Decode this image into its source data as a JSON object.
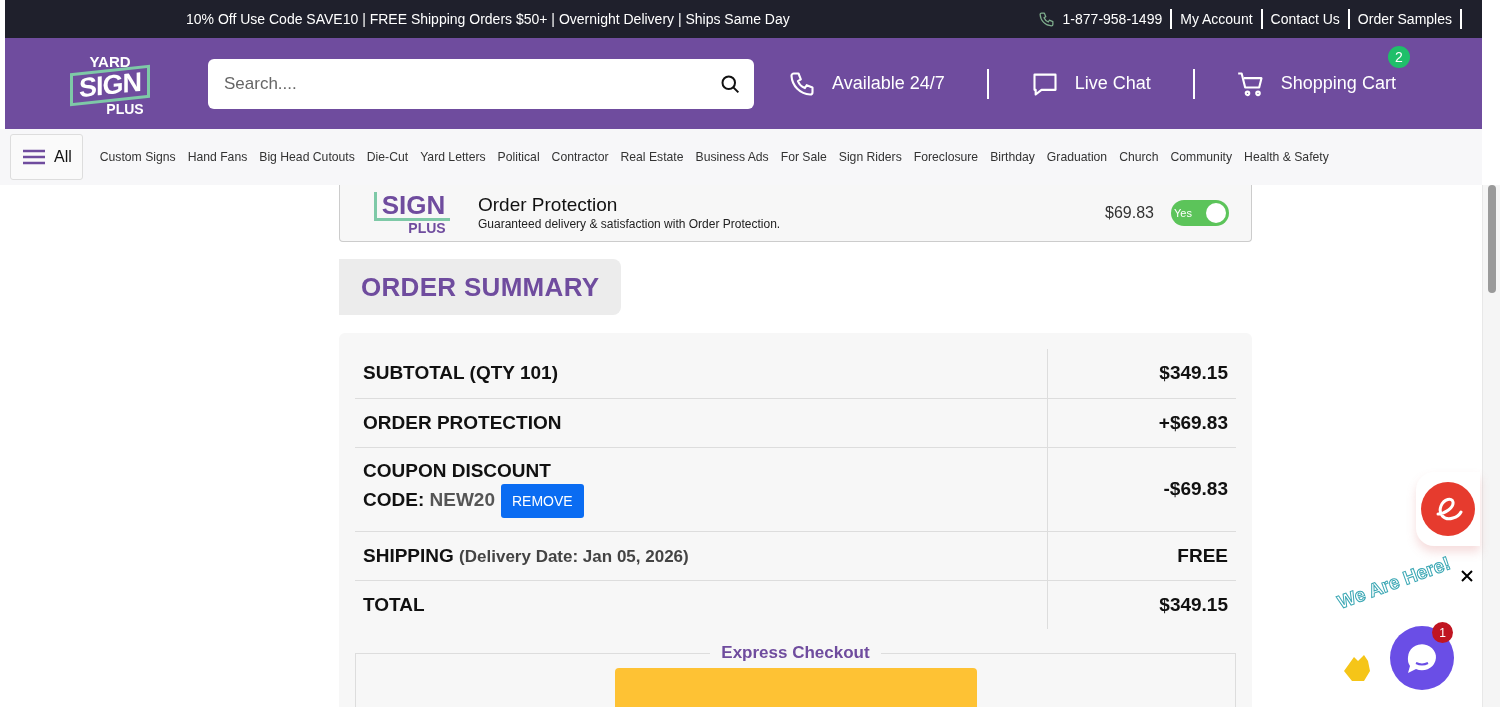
{
  "announcement": "10% Off Use Code SAVE10 | FREE Shipping Orders $50+ | Overnight Delivery | Ships Same Day",
  "top_links": [
    {
      "kind": "phone",
      "label": "1-877-958-1499"
    },
    {
      "kind": "link",
      "label": "My Account"
    },
    {
      "kind": "link",
      "label": "Contact Us"
    },
    {
      "kind": "link",
      "label": "Order Samples"
    }
  ],
  "header": {
    "logo": [
      "YARD",
      "SIGN",
      "PLUS"
    ],
    "search": {
      "placeholder": "Search...."
    },
    "actions": [
      {
        "kind": "phone",
        "label": "Available 24/7"
      },
      {
        "kind": "chat",
        "label": "Live Chat"
      },
      {
        "kind": "cart",
        "label": "Shopping Cart",
        "badge": "2"
      }
    ]
  },
  "nav": {
    "menu_label": "All",
    "items": [
      "Custom Signs",
      "Hand Fans",
      "Big Head Cutouts",
      "Die-Cut",
      "Yard Letters",
      "Political",
      "Contractor",
      "Real Estate",
      "Business Ads",
      "For Sale",
      "Sign Riders",
      "Foreclosure",
      "Birthday",
      "Graduation",
      "Church",
      "Community",
      "Health & Safety"
    ]
  },
  "order_protection": {
    "logo": [
      "SIGN",
      "PLUS"
    ],
    "title": "Order Protection",
    "description": "Guaranteed delivery & satisfaction with Order Protection.",
    "price": "$69.83",
    "toggle": {
      "label": "Yes",
      "on": true
    }
  },
  "summary": {
    "title": "ORDER SUMMARY",
    "rows": [
      {
        "kind": "line",
        "label": "SUBTOTAL (QTY 101)",
        "value": "$349.15"
      },
      {
        "kind": "line",
        "label": "ORDER PROTECTION",
        "value": "+$69.83"
      },
      {
        "kind": "coupon",
        "label": "COUPON DISCOUNT",
        "code_label": "CODE:",
        "code": "NEW20",
        "button": "REMOVE",
        "value": "-$69.83"
      },
      {
        "kind": "shipping",
        "label": "SHIPPING",
        "note": "(Delivery Date: Jan 05, 2026)",
        "value": "FREE"
      },
      {
        "kind": "total",
        "label": "TOTAL",
        "value": "$349.15"
      }
    ]
  },
  "express_checkout": {
    "title": "Express Checkout"
  },
  "chat_widget": {
    "tagline": "We Are Here!",
    "badge": "1"
  }
}
